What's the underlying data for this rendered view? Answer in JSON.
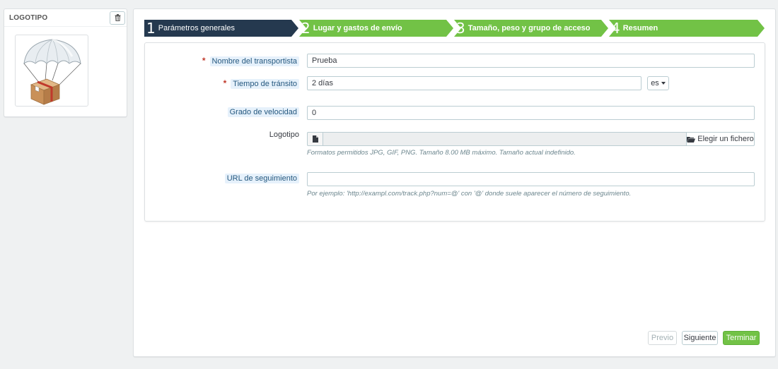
{
  "logo_panel": {
    "title": "LOGOTIPO"
  },
  "steps": [
    {
      "num": "1",
      "label": "Parámetros generales",
      "active": true
    },
    {
      "num": "2",
      "label": "Lugar y gastos de envío",
      "active": false
    },
    {
      "num": "3",
      "label": "Tamaño, peso y grupo de acceso",
      "active": false
    },
    {
      "num": "4",
      "label": "Resumen",
      "active": false
    }
  ],
  "form": {
    "carrier_name": {
      "label": "Nombre del transportista",
      "required": "*",
      "value": "Prueba"
    },
    "transit_time": {
      "label": "Tiempo de tránsito",
      "required": "*",
      "value": "2 días",
      "lang": "es"
    },
    "speed_grade": {
      "label": "Grado de velocidad",
      "value": "0"
    },
    "logo": {
      "label": "Logotipo",
      "button_label": "Elegir un fichero",
      "hint": "Formatos permitidos JPG, GIF, PNG. Tamaño 8.00 MB máximo. Tamaño actual indefinido."
    },
    "tracking_url": {
      "label": "URL de seguimiento",
      "value": "",
      "hint": "Por ejemplo: 'http://exampl.com/track.php?num=@' con '@' donde suele aparecer el número de seguimiento."
    }
  },
  "footer": {
    "prev_label": "Previo",
    "next_label": "Siguiente",
    "finish_label": "Terminar"
  },
  "colors": {
    "step_active": "#25394f",
    "step_inactive": "#72c246",
    "finish_button": "#72c246",
    "required": "#c0392b"
  }
}
